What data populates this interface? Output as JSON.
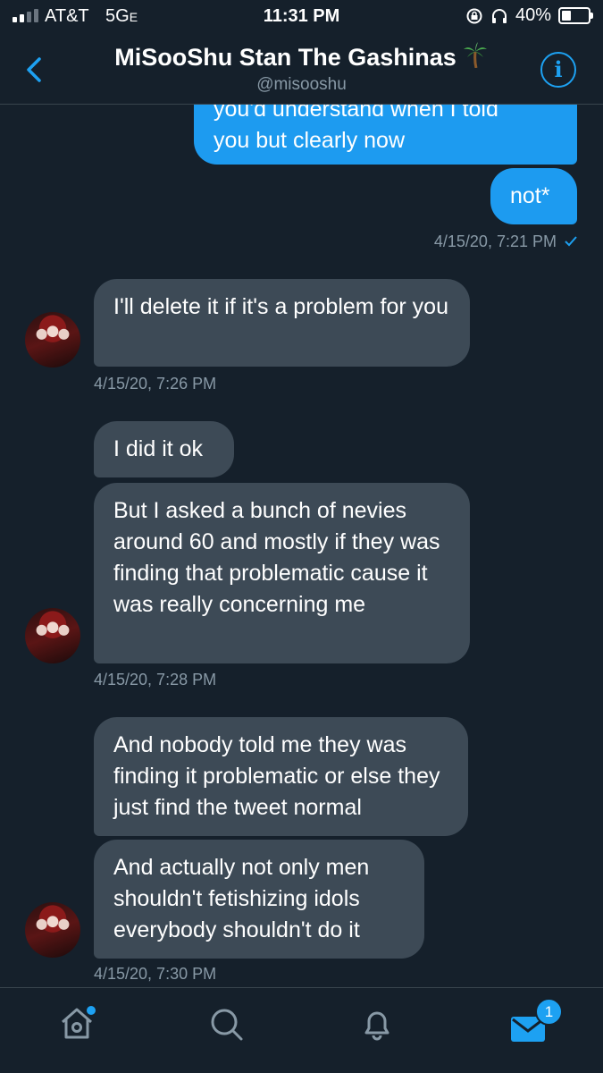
{
  "status_bar": {
    "carrier": "AT&T",
    "network": "5G",
    "network_suffix": "E",
    "time": "11:31 PM",
    "battery": "40%"
  },
  "header": {
    "title": "MiSooShu Stan The Gashinas",
    "handle": "@misooshu",
    "info_glyph": "i"
  },
  "messages": {
    "sent_1_partial": "you'd understand when I told",
    "sent_1": "you but clearly now",
    "sent_2": "not*",
    "sent_stamp": "4/15/20, 7:21 PM",
    "recv_1": "I'll delete it if it's a problem for you",
    "recv_1_stamp": "4/15/20, 7:26 PM",
    "recv_2": "I did it ok",
    "recv_3": "But I asked a bunch of nevies around 60 and mostly if they was finding that problematic cause it was really concerning me",
    "recv_3_stamp": "4/15/20, 7:28 PM",
    "recv_4": "And nobody told me they was finding it problematic or else they just find the tweet normal",
    "recv_5": "And actually not only men shouldn't fetishizing idols everybody shouldn't do it",
    "recv_5_stamp": "4/15/20, 7:30 PM"
  },
  "nav": {
    "messages_badge": "1"
  },
  "colors": {
    "background": "#15202b",
    "sent_bubble": "#1d9bf0",
    "received_bubble": "#3d4a56",
    "accent": "#1da1f2",
    "muted": "#8899a6"
  }
}
